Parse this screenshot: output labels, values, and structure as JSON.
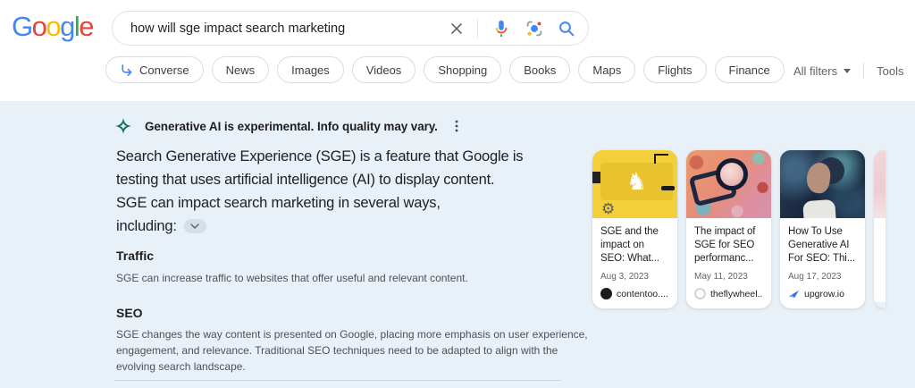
{
  "header": {
    "logo_letters": [
      "G",
      "o",
      "o",
      "g",
      "l",
      "e"
    ],
    "search": {
      "query": "how will sge impact search marketing"
    },
    "tabs": [
      {
        "label": "Converse"
      },
      {
        "label": "News"
      },
      {
        "label": "Images"
      },
      {
        "label": "Videos"
      },
      {
        "label": "Shopping"
      },
      {
        "label": "Books"
      },
      {
        "label": "Maps"
      },
      {
        "label": "Flights"
      },
      {
        "label": "Finance"
      }
    ],
    "all_filters": "All filters",
    "tools": "Tools"
  },
  "sge": {
    "disclaimer": "Generative AI is experimental. Info quality may vary.",
    "answer_lines": [
      "Search Generative Experience (SGE) is a feature that Google is",
      "testing that uses artificial intelligence (AI) to display content.",
      "SGE can impact search marketing in several ways,",
      "including:"
    ],
    "sections": [
      {
        "heading": "Traffic",
        "body_lines": [
          "SGE can increase traffic to websites that offer useful and relevant content."
        ]
      },
      {
        "heading": "SEO",
        "body_lines": [
          "SGE changes the way content is presented on Google, placing more emphasis on user experience,",
          "engagement, and relevance. Traditional SEO techniques need to be adapted to align with the",
          "evolving search landscape."
        ]
      }
    ],
    "cards": [
      {
        "title": "SGE and the impact on SEO: What...",
        "date": "Aug 3, 2023",
        "source": "contentoo....",
        "image": "yellow-chess-knight-illustration"
      },
      {
        "title": "The impact of SGE for SEO performanc...",
        "date": "May 11, 2023",
        "source": "theflywheel...",
        "image": "colorful-abstract-magnifier"
      },
      {
        "title": "How To Use Generative AI For SEO: Thi...",
        "date": "Aug 17, 2023",
        "source": "upgrow.io",
        "image": "dark-ai-portrait"
      }
    ],
    "card_glyphs": {
      "knight": "♞",
      "gear": "⚙"
    }
  },
  "colors": {
    "google_blue": "#4285F4",
    "google_red": "#EA4335",
    "google_yellow": "#FBBC05",
    "google_green": "#34A853",
    "sge_background": "#E9F1F8",
    "sge_icon_teal": "#0E6A5E",
    "card1_yellow": "#F2CF3B",
    "body_text_gray": "#4D5156"
  }
}
